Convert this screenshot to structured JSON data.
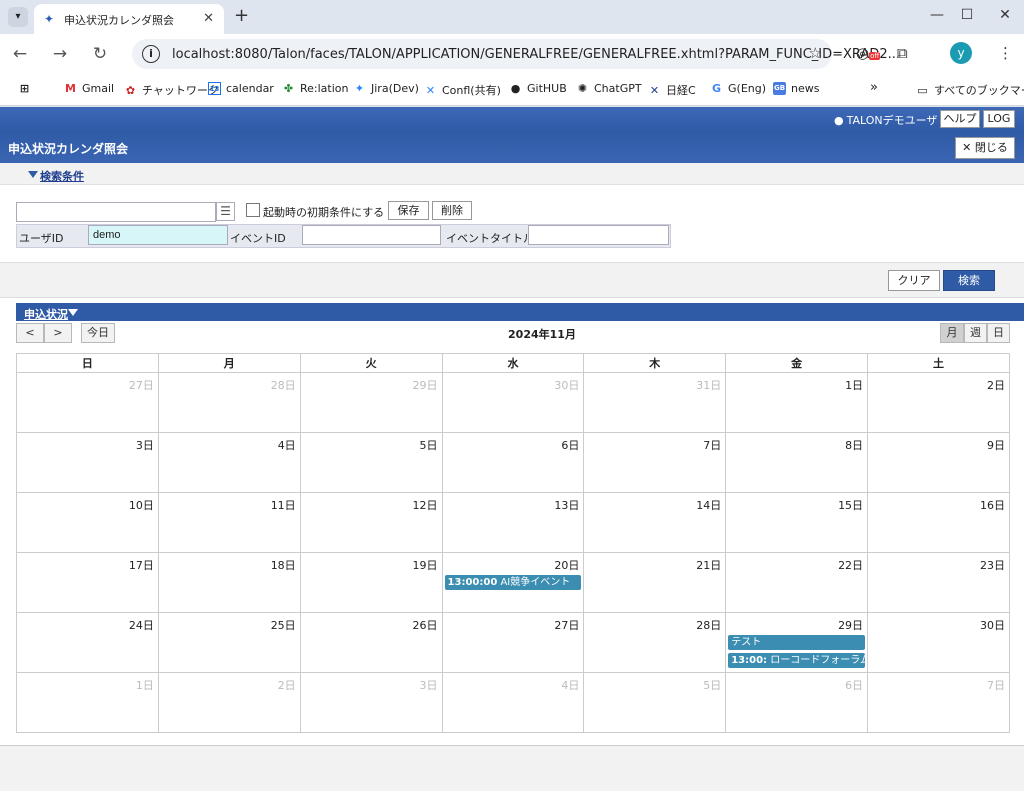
{
  "browser": {
    "tab_title": "申込状況カレンダ照会",
    "url": "localhost:8080/Talon/faces/TALON/APPLICATION/GENERALFREE/GENERALFREE.xhtml?PARAM_FUNC_ID=XRAD2...",
    "profile_initial": "y",
    "extension_badge": "off",
    "bookmarks": [
      "Gmail",
      "チャットワーク",
      "calendar",
      "Re:lation",
      "Jira(Dev)",
      "Confl(共有)",
      "GitHUB",
      "ChatGPT",
      "日経C",
      "G(Eng)",
      "news"
    ],
    "bookmarks_more": "»",
    "all_bookmarks": "すべてのブックマーク"
  },
  "header": {
    "user": "TALONデモユーザ",
    "help": "ヘルプ",
    "log": "LOG"
  },
  "title_bar": {
    "title": "申込状況カレンダ照会",
    "close": "閉じる"
  },
  "search": {
    "section_label": "検索条件",
    "preset_value": "",
    "startup_checkbox": "起動時の初期条件にする",
    "save": "保存",
    "delete": "削除",
    "user_id_label": "ユーザID",
    "user_id_value": "demo",
    "event_id_label": "イベントID",
    "event_id_value": "",
    "event_title_label": "イベントタイトル",
    "event_title_value": "",
    "clear": "クリア",
    "search": "検索"
  },
  "calendar": {
    "section_label": "申込状況",
    "prev": "<",
    "next": ">",
    "today": "今日",
    "title": "2024年11月",
    "views": [
      "月",
      "週",
      "日"
    ],
    "active_view": "月",
    "weekdays": [
      "日",
      "月",
      "火",
      "水",
      "木",
      "金",
      "土"
    ],
    "weeks": [
      [
        {
          "d": "27日",
          "o": true
        },
        {
          "d": "28日",
          "o": true
        },
        {
          "d": "29日",
          "o": true
        },
        {
          "d": "30日",
          "o": true
        },
        {
          "d": "31日",
          "o": true
        },
        {
          "d": "1日"
        },
        {
          "d": "2日"
        }
      ],
      [
        {
          "d": "3日"
        },
        {
          "d": "4日"
        },
        {
          "d": "5日"
        },
        {
          "d": "6日"
        },
        {
          "d": "7日"
        },
        {
          "d": "8日"
        },
        {
          "d": "9日"
        }
      ],
      [
        {
          "d": "10日"
        },
        {
          "d": "11日"
        },
        {
          "d": "12日"
        },
        {
          "d": "13日"
        },
        {
          "d": "14日"
        },
        {
          "d": "15日"
        },
        {
          "d": "16日"
        }
      ],
      [
        {
          "d": "17日"
        },
        {
          "d": "18日"
        },
        {
          "d": "19日"
        },
        {
          "d": "20日",
          "events": [
            {
              "time": "13:00:00",
              "title": "AI競争イベント"
            }
          ]
        },
        {
          "d": "21日"
        },
        {
          "d": "22日"
        },
        {
          "d": "23日"
        }
      ],
      [
        {
          "d": "24日"
        },
        {
          "d": "25日"
        },
        {
          "d": "26日"
        },
        {
          "d": "27日"
        },
        {
          "d": "28日"
        },
        {
          "d": "29日",
          "events": [
            {
              "time": "",
              "title": "テスト"
            },
            {
              "time": "13:00:",
              "title": "ローコードフォーラム"
            }
          ]
        },
        {
          "d": "30日"
        }
      ],
      [
        {
          "d": "1日",
          "o": true
        },
        {
          "d": "2日",
          "o": true
        },
        {
          "d": "3日",
          "o": true
        },
        {
          "d": "4日",
          "o": true
        },
        {
          "d": "5日",
          "o": true
        },
        {
          "d": "6日",
          "o": true
        },
        {
          "d": "7日",
          "o": true
        }
      ]
    ]
  }
}
